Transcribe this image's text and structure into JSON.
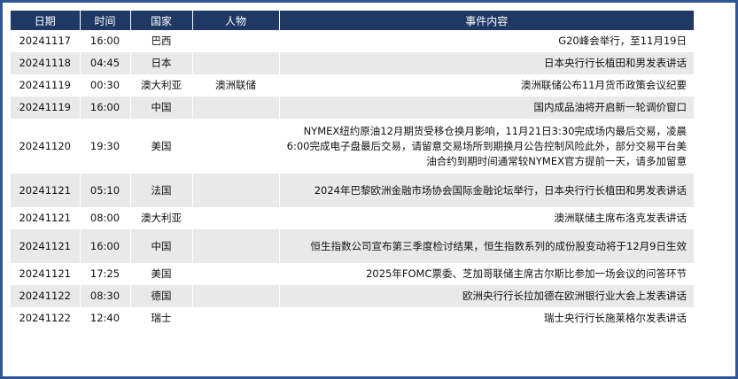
{
  "table": {
    "headers": [
      "日期",
      "时间",
      "国家",
      "人物",
      "事件内容"
    ],
    "rows": [
      {
        "date": "20241117",
        "time": "16:00",
        "country": "巴西",
        "person": "",
        "event": "G20峰会举行，至11月19日"
      },
      {
        "date": "20241118",
        "time": "04:45",
        "country": "日本",
        "person": "",
        "event": "日本央行行长植田和男发表讲话"
      },
      {
        "date": "20241119",
        "time": "00:30",
        "country": "澳大利亚",
        "person": "澳洲联储",
        "event": "澳洲联储公布11月货币政策会议纪要"
      },
      {
        "date": "20241119",
        "time": "16:00",
        "country": "中国",
        "person": "",
        "event": "国内成品油将开启新一轮调价窗口"
      },
      {
        "date": "20241120",
        "time": "19:30",
        "country": "美国",
        "person": "",
        "event": "NYMEX纽约原油12月期货受移仓换月影响，11月21日3:30完成场内最后交易，凌晨6:00完成电子盘最后交易，请留意交易场所到期换月公告控制风险此外，部分交易平台美油合约到期时间通常较NYMEX官方提前一天，请多加留意"
      },
      {
        "date": "20241121",
        "time": "05:10",
        "country": "法国",
        "person": "",
        "event": "2024年巴黎欧洲金融市场协会国际金融论坛举行，日本央行行长植田和男发表讲话"
      },
      {
        "date": "20241121",
        "time": "08:00",
        "country": "澳大利亚",
        "person": "",
        "event": "澳洲联储主席布洛克发表讲话"
      },
      {
        "date": "20241121",
        "time": "16:00",
        "country": "中国",
        "person": "",
        "event": "恒生指数公司宣布第三季度检讨结果，恒生指数系列的成份股变动将于12月9日生效"
      },
      {
        "date": "20241121",
        "time": "17:25",
        "country": "美国",
        "person": "",
        "event": "2025年FOMC票委、芝加哥联储主席古尔斯比参加一场会议的问答环节"
      },
      {
        "date": "20241122",
        "time": "08:30",
        "country": "德国",
        "person": "",
        "event": "欧洲央行行长拉加德在欧洲银行业大会上发表讲话"
      },
      {
        "date": "20241122",
        "time": "12:40",
        "country": "瑞士",
        "person": "",
        "event": "瑞士央行行长施莱格尔发表讲话"
      }
    ]
  }
}
